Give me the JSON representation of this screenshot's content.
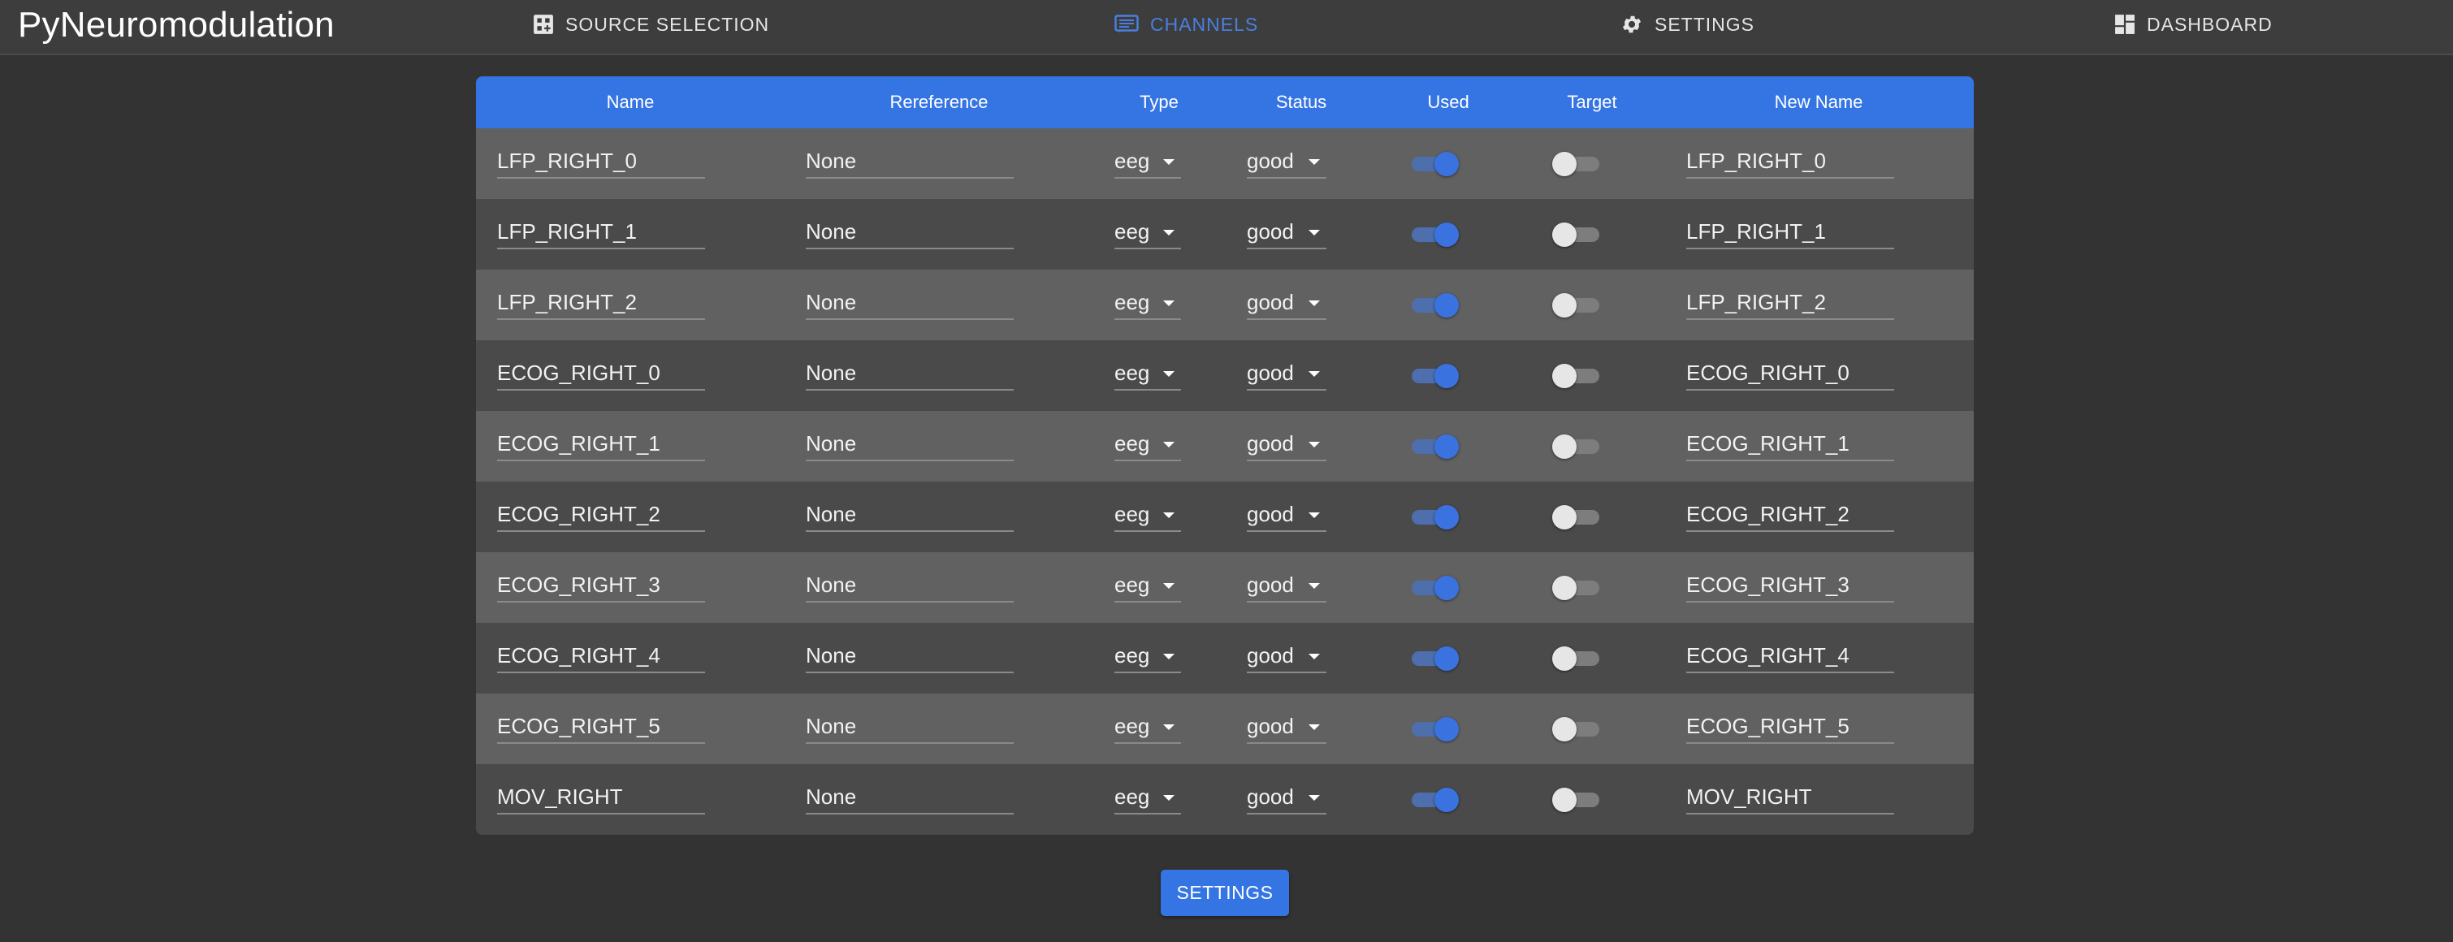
{
  "app": {
    "title": "PyNeuromodulation"
  },
  "nav": [
    {
      "label": "SOURCE SELECTION",
      "icon": "grid-plus-icon",
      "active": false
    },
    {
      "label": "CHANNELS",
      "icon": "list-box-icon",
      "active": true
    },
    {
      "label": "SETTINGS",
      "icon": "gear-icon",
      "active": false
    },
    {
      "label": "DASHBOARD",
      "icon": "dashboard-icon",
      "active": false
    }
  ],
  "table": {
    "headers": [
      "Name",
      "Rereference",
      "Type",
      "Status",
      "Used",
      "Target",
      "New Name"
    ],
    "rows": [
      {
        "name": "LFP_RIGHT_0",
        "rereference": "None",
        "type": "eeg",
        "status": "good",
        "used": true,
        "target": false,
        "new_name": "LFP_RIGHT_0"
      },
      {
        "name": "LFP_RIGHT_1",
        "rereference": "None",
        "type": "eeg",
        "status": "good",
        "used": true,
        "target": false,
        "new_name": "LFP_RIGHT_1"
      },
      {
        "name": "LFP_RIGHT_2",
        "rereference": "None",
        "type": "eeg",
        "status": "good",
        "used": true,
        "target": false,
        "new_name": "LFP_RIGHT_2"
      },
      {
        "name": "ECOG_RIGHT_0",
        "rereference": "None",
        "type": "eeg",
        "status": "good",
        "used": true,
        "target": false,
        "new_name": "ECOG_RIGHT_0"
      },
      {
        "name": "ECOG_RIGHT_1",
        "rereference": "None",
        "type": "eeg",
        "status": "good",
        "used": true,
        "target": false,
        "new_name": "ECOG_RIGHT_1"
      },
      {
        "name": "ECOG_RIGHT_2",
        "rereference": "None",
        "type": "eeg",
        "status": "good",
        "used": true,
        "target": false,
        "new_name": "ECOG_RIGHT_2"
      },
      {
        "name": "ECOG_RIGHT_3",
        "rereference": "None",
        "type": "eeg",
        "status": "good",
        "used": true,
        "target": false,
        "new_name": "ECOG_RIGHT_3"
      },
      {
        "name": "ECOG_RIGHT_4",
        "rereference": "None",
        "type": "eeg",
        "status": "good",
        "used": true,
        "target": false,
        "new_name": "ECOG_RIGHT_4"
      },
      {
        "name": "ECOG_RIGHT_5",
        "rereference": "None",
        "type": "eeg",
        "status": "good",
        "used": true,
        "target": false,
        "new_name": "ECOG_RIGHT_5"
      },
      {
        "name": "MOV_RIGHT",
        "rereference": "None",
        "type": "eeg",
        "status": "good",
        "used": true,
        "target": false,
        "new_name": "MOV_RIGHT"
      }
    ]
  },
  "footer": {
    "settings_button_label": "SETTINGS"
  },
  "colors": {
    "accent": "#3575e3",
    "background": "#333333",
    "row_light": "#616161",
    "row_dark": "#4a4a4a"
  }
}
